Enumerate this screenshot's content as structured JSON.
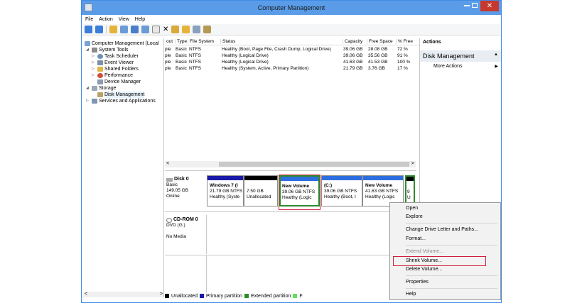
{
  "window": {
    "title": "Computer Management"
  },
  "menubar": [
    "File",
    "Action",
    "View",
    "Help"
  ],
  "tree": {
    "root": "Computer Management (Local",
    "system_tools": "System Tools",
    "task_scheduler": "Task Scheduler",
    "event_viewer": "Event Viewer",
    "shared_folders": "Shared Folders",
    "performance": "Performance",
    "device_manager": "Device Manager",
    "storage": "Storage",
    "disk_management": "Disk Management",
    "services": "Services and Applications"
  },
  "table": {
    "headers": [
      "out",
      "Type",
      "File System",
      "Status",
      "Capacity",
      "Free Space",
      "% Free"
    ],
    "rows": [
      [
        "ple",
        "Basic",
        "NTFS",
        "Healthy (Boot, Page File, Crash Dump, Logical Drive)",
        "39.06 GB",
        "28.08 GB",
        "72 %"
      ],
      [
        "ple",
        "Basic",
        "NTFS",
        "Healthy (Logical Drive)",
        "39.06 GB",
        "35.56 GB",
        "91 %"
      ],
      [
        "ple",
        "Basic",
        "NTFS",
        "Healthy (Logical Drive)",
        "41.63 GB",
        "41.53 GB",
        "100 %"
      ],
      [
        "ple",
        "Basic",
        "NTFS",
        "Healthy (System, Active, Primary Partition)",
        "21.79 GB",
        "3.76 GB",
        "17 %"
      ]
    ]
  },
  "actions": {
    "header": "Actions",
    "section": "Disk Management",
    "more": "More Actions"
  },
  "disk0": {
    "name": "Disk 0",
    "type": "Basic",
    "size": "149.05 GB",
    "status": "Online",
    "partitions": [
      {
        "line1": "Windows 7 (I",
        "line2": "21.79 GB NTFS",
        "line3": "Healthy (Syste"
      },
      {
        "line1": "",
        "line2": "7.50 GB",
        "line3": "Unallocated"
      },
      {
        "line1": "New Volume",
        "line2": "39.06 GB NTFS",
        "line3": "Healthy (Logic"
      },
      {
        "line1": "(C:)",
        "line2": "39.06 GB NTFS",
        "line3": "Healthy (Boot, I"
      },
      {
        "line1": "New Volume",
        "line2": "41.63 GB NTFS",
        "line3": "Healthy (Logic"
      },
      {
        "line1": "",
        "line2": "9",
        "line3": "U"
      }
    ]
  },
  "cdrom": {
    "name": "CD-ROM 0",
    "type": "DVD (G:)",
    "media": "No Media"
  },
  "legend": [
    "Unallocated",
    "Primary partition",
    "Extended partition",
    "F"
  ],
  "context_menu": {
    "open": "Open",
    "explore": "Explore",
    "change_letter": "Change Drive Letter and Paths...",
    "format": "Format...",
    "extend": "Extend Volume...",
    "shrink": "Shrink Volume...",
    "delete": "Delete Volume...",
    "properties": "Properties",
    "help": "Help"
  },
  "colors": {
    "accent": "#5a9ce8",
    "primary": "#1a1aa8",
    "unallocated": "#000000",
    "extended": "#2f8a2f",
    "logical": "#2d6fe0",
    "highlight": "#d21e3c"
  }
}
